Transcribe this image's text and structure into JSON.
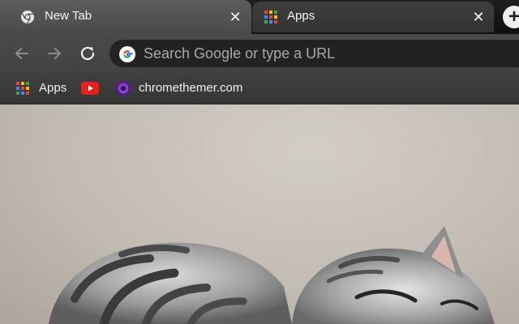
{
  "tabs": [
    {
      "title": "New Tab",
      "icon": "chrome-icon",
      "active": true
    },
    {
      "title": "Apps",
      "icon": "apps-grid-icon",
      "active": false
    }
  ],
  "tab_close_label": "✕",
  "new_tab_label": "+",
  "toolbar": {
    "back_icon": "arrow-left-icon",
    "forward_icon": "arrow-right-icon",
    "reload_icon": "reload-icon",
    "omnibox_placeholder": "Search Google or type a URL"
  },
  "bookmarks": [
    {
      "label": "Apps",
      "icon": "apps-grid-icon"
    },
    {
      "label": "",
      "icon": "youtube-icon"
    },
    {
      "label": "chromethemer.com",
      "icon": "chromethemer-icon"
    }
  ],
  "colors": {
    "tabstrip": "#141414",
    "active_tab": "#545454",
    "toolbar": "#464646",
    "omnibox": "#222222",
    "youtube_red": "#e62117",
    "chromethemer_purple": "#6a2fa0"
  }
}
